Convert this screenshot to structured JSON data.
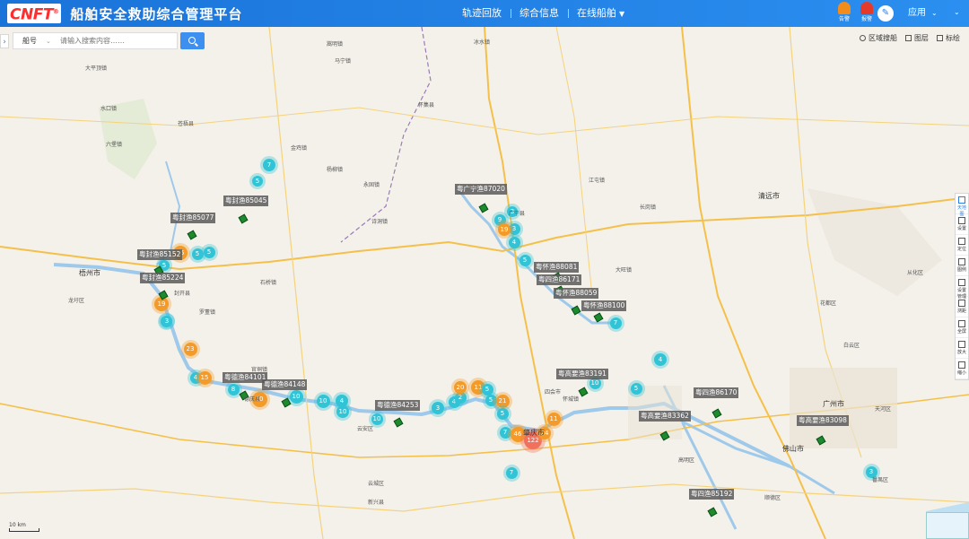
{
  "header": {
    "logo": "CNFT",
    "logo_mark": "®",
    "title": "船舶安全救助综合管理平台",
    "nav": [
      {
        "label": "轨迹回放",
        "caret": false
      },
      {
        "label": "综合信息",
        "caret": false
      },
      {
        "label": "在线船舶",
        "caret": true
      }
    ],
    "icons": [
      {
        "name": "alarm-orange-icon",
        "label": "告警"
      },
      {
        "name": "alarm-red-icon",
        "label": "报警"
      }
    ],
    "user_label": "应用"
  },
  "search": {
    "type_label": "船号",
    "placeholder": "请输入搜索内容……"
  },
  "tools": [
    {
      "label": "区域搜船"
    },
    {
      "label": "图层"
    },
    {
      "label": "标绘"
    }
  ],
  "vertical_tools": [
    {
      "label": "天地图",
      "active": true
    },
    {
      "label": "设置"
    },
    {
      "label": "定位"
    },
    {
      "label": "图例"
    },
    {
      "label": "设置管理"
    },
    {
      "label": "测距"
    },
    {
      "label": "全屏"
    },
    {
      "label": "放大"
    },
    {
      "label": "缩小"
    }
  ],
  "clusters": [
    {
      "v": "7",
      "c": "cyan"
    },
    {
      "v": "5",
      "c": "cyan"
    },
    {
      "v": "5",
      "c": "cyan"
    },
    {
      "v": "15",
      "c": "orange"
    },
    {
      "v": "5",
      "c": "cyan"
    },
    {
      "v": "5",
      "c": "cyan"
    },
    {
      "v": "19",
      "c": "orange"
    },
    {
      "v": "3",
      "c": "cyan"
    },
    {
      "v": "23",
      "c": "orange"
    },
    {
      "v": "4",
      "c": "cyan"
    },
    {
      "v": "15",
      "c": "orange"
    },
    {
      "v": "8",
      "c": "cyan"
    },
    {
      "v": "20",
      "c": "orange"
    },
    {
      "v": "10",
      "c": "cyan"
    },
    {
      "v": "10",
      "c": "cyan"
    },
    {
      "v": "4",
      "c": "cyan"
    },
    {
      "v": "10",
      "c": "cyan"
    },
    {
      "v": "10",
      "c": "cyan"
    },
    {
      "v": "3",
      "c": "cyan"
    },
    {
      "v": "4",
      "c": "cyan"
    },
    {
      "v": "2",
      "c": "cyan"
    },
    {
      "v": "20",
      "c": "orange"
    },
    {
      "v": "11",
      "c": "orange"
    },
    {
      "v": "5",
      "c": "cyan"
    },
    {
      "v": "5",
      "c": "cyan"
    },
    {
      "v": "21",
      "c": "orange"
    },
    {
      "v": "5",
      "c": "cyan"
    },
    {
      "v": "7",
      "c": "cyan"
    },
    {
      "v": "46",
      "c": "orange"
    },
    {
      "v": "122",
      "c": "red"
    },
    {
      "v": "24",
      "c": "orange"
    },
    {
      "v": "11",
      "c": "orange"
    },
    {
      "v": "7",
      "c": "cyan"
    },
    {
      "v": "3",
      "c": "cyan"
    },
    {
      "v": "10",
      "c": "cyan"
    },
    {
      "v": "5",
      "c": "cyan"
    },
    {
      "v": "4",
      "c": "cyan"
    },
    {
      "v": "7",
      "c": "cyan"
    },
    {
      "v": "9",
      "c": "cyan"
    },
    {
      "v": "19",
      "c": "orange"
    },
    {
      "v": "3",
      "c": "cyan"
    },
    {
      "v": "4",
      "c": "cyan"
    },
    {
      "v": "5",
      "c": "cyan"
    },
    {
      "v": "3",
      "c": "cyan"
    },
    {
      "v": "3",
      "c": "cyan"
    }
  ],
  "ship_labels": [
    "粤封渔85045",
    "粤封渔85077",
    "粤封渔85152",
    "粤封渔85224",
    "粤德渔84101",
    "粤德渔84148",
    "粤德渔84253",
    "粤广宁渔87020",
    "粤怀渔88081",
    "粤四渔86171",
    "粤怀渔88059",
    "粤怀渔88100",
    "粤高要渔83191",
    "粤四渔86170",
    "粤高要渔83362",
    "粤高要渔83098",
    "粤四渔85192"
  ],
  "places": [
    "嵩明镇",
    "马宁镇",
    "冰水镇",
    "怀集县",
    "大平顶镇",
    "水口镇",
    "苍梧县",
    "六堡镇",
    "金鸡镇",
    "杨柳镇",
    "永固镇",
    "诗洞镇",
    "广宁县",
    "清远市",
    "梧州市",
    "龙圩区",
    "封开县",
    "罗董镇",
    "石桥镇",
    "官垌镇",
    "德庆县",
    "云安区",
    "肇庆市",
    "四会市",
    "广州市",
    "佛山市",
    "番禺区",
    "天河区",
    "花都区",
    "新兴县",
    "云城区",
    "高明区",
    "顺德区",
    "白云区",
    "从化区",
    "大旺镇",
    "怀城镇",
    "江屯镇",
    "长岗镇"
  ],
  "scale_label": "10 km"
}
